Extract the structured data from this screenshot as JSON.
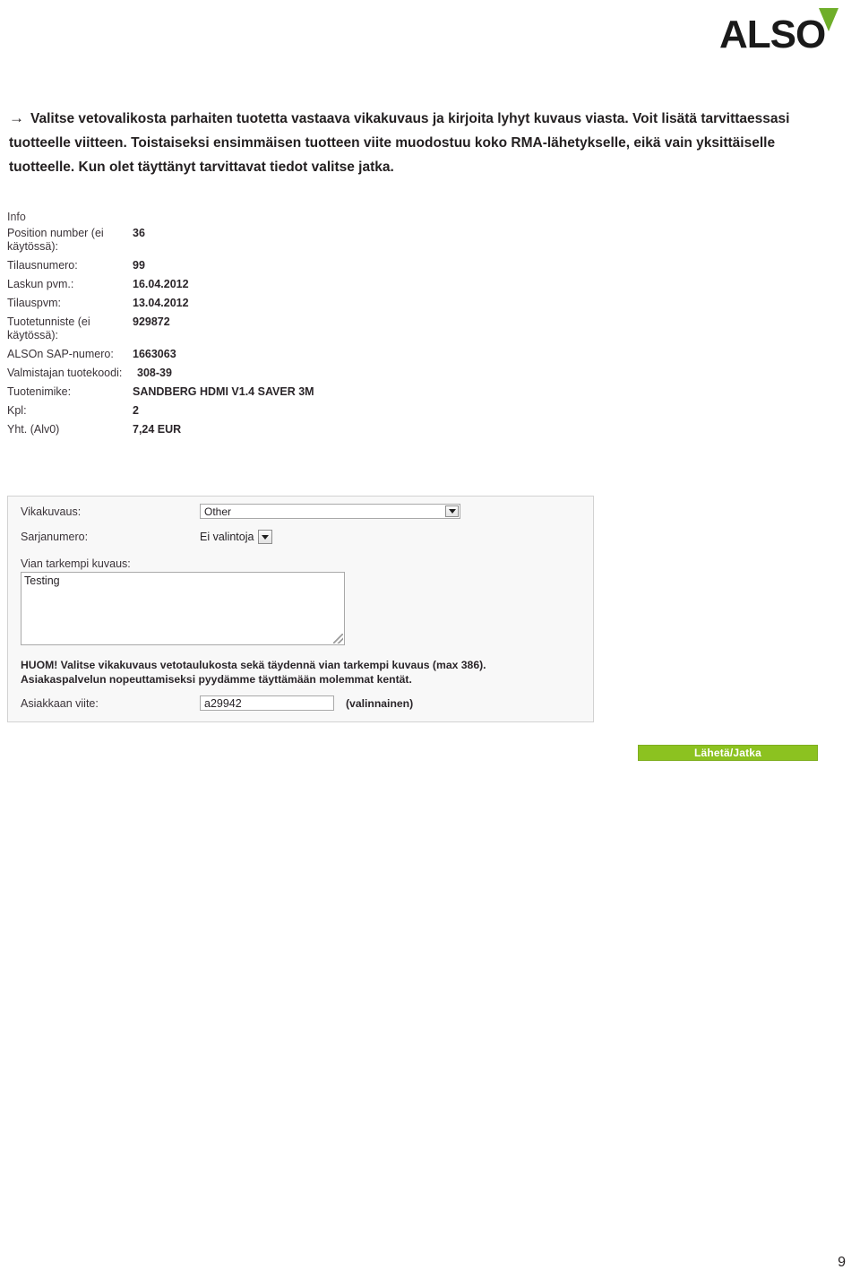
{
  "logo": {
    "word": "ALSO",
    "accent_color": "#6fae2a",
    "text_color": "#1a1a1a"
  },
  "intro": {
    "arrow": "→",
    "text": "Valitse vetovalikosta parhaiten tuotetta vastaava vikakuvaus ja kirjoita lyhyt kuvaus viasta. Voit lisätä tarvittaessasi tuotteelle viitteen. Toistaiseksi ensimmäisen tuotteen viite muodostuu koko RMA-lähetykselle, eikä vain yksittäiselle tuotteelle. Kun olet täyttänyt tarvittavat tiedot valitse jatka."
  },
  "info": {
    "title": "Info",
    "rows": [
      {
        "label": "Position number (ei käytössä):",
        "value": "36"
      },
      {
        "label": "Tilausnumero:",
        "value": "99"
      },
      {
        "label": "Laskun pvm.:",
        "value": "16.04.2012"
      },
      {
        "label": "Tilauspvm:",
        "value": "13.04.2012"
      },
      {
        "label": "Tuotetunniste (ei käytössä):",
        "value": "929872"
      },
      {
        "label": "ALSOn SAP-numero:",
        "value": "1663063"
      },
      {
        "label": "Valmistajan tuotekoodi:",
        "value": "308-39"
      },
      {
        "label": "Tuotenimike:",
        "value": "SANDBERG HDMI V1.4 SAVER 3M"
      },
      {
        "label": "Kpl:",
        "value": "2"
      },
      {
        "label": "Yht. (Alv0)",
        "value": "7,24 EUR"
      }
    ]
  },
  "form": {
    "fault_description": {
      "label": "Vikakuvaus:",
      "selected": "Other"
    },
    "serial_number": {
      "label": "Sarjanumero:",
      "selected": "Ei valintoja"
    },
    "detailed_description": {
      "label": "Vian tarkempi kuvaus:",
      "value": "Testing"
    },
    "note": {
      "line1": "HUOM! Valitse vikakuvaus vetotaulukosta sekä täydennä vian tarkempi kuvaus (max 386).",
      "line2": "Asiakaspalvelun nopeuttamiseksi pyydämme täyttämään molemmat kentät."
    },
    "customer_reference": {
      "label": "Asiakkaan viite:",
      "value": "a29942",
      "hint": "(valinnainen)"
    }
  },
  "submit": {
    "label": "Lähetä/Jatka",
    "color": "#8cc220"
  },
  "footer": {
    "page_number": "9"
  }
}
